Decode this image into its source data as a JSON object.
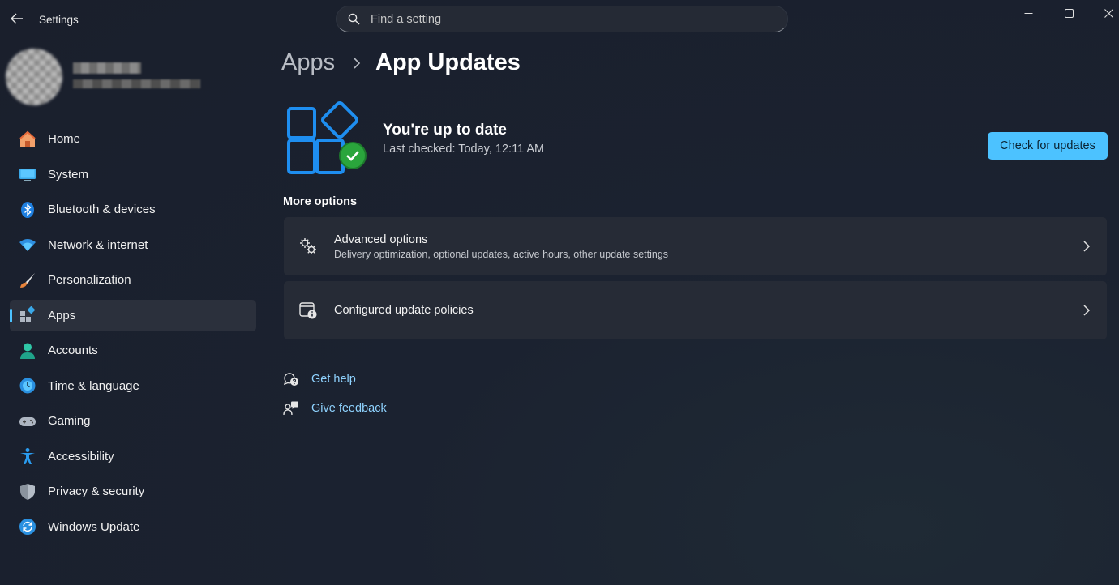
{
  "window": {
    "title": "Settings"
  },
  "search": {
    "placeholder": "Find a setting"
  },
  "sidebar": {
    "items": [
      {
        "label": "Home",
        "icon": "home-icon"
      },
      {
        "label": "System",
        "icon": "monitor-icon"
      },
      {
        "label": "Bluetooth & devices",
        "icon": "bluetooth-icon"
      },
      {
        "label": "Network & internet",
        "icon": "wifi-icon"
      },
      {
        "label": "Personalization",
        "icon": "brush-icon"
      },
      {
        "label": "Apps",
        "icon": "apps-icon",
        "selected": true
      },
      {
        "label": "Accounts",
        "icon": "person-icon"
      },
      {
        "label": "Time & language",
        "icon": "globe-clock-icon"
      },
      {
        "label": "Gaming",
        "icon": "gamepad-icon"
      },
      {
        "label": "Accessibility",
        "icon": "accessibility-icon"
      },
      {
        "label": "Privacy & security",
        "icon": "shield-icon"
      },
      {
        "label": "Windows Update",
        "icon": "sync-icon"
      }
    ]
  },
  "breadcrumb": {
    "parent": "Apps",
    "current": "App Updates"
  },
  "status": {
    "title": "You're up to date",
    "last_checked": "Last checked: Today, 12:11 AM",
    "check_button": "Check for updates"
  },
  "more_options": {
    "heading": "More options",
    "cards": [
      {
        "title": "Advanced options",
        "subtitle": "Delivery optimization, optional updates, active hours, other update settings",
        "icon": "gears-icon"
      },
      {
        "title": "Configured update policies",
        "icon": "policy-info-icon"
      }
    ]
  },
  "links": {
    "help": "Get help",
    "feedback": "Give feedback"
  },
  "colors": {
    "accent": "#4cc2ff",
    "link": "#8fd3ff",
    "success": "#1f9a2f"
  }
}
